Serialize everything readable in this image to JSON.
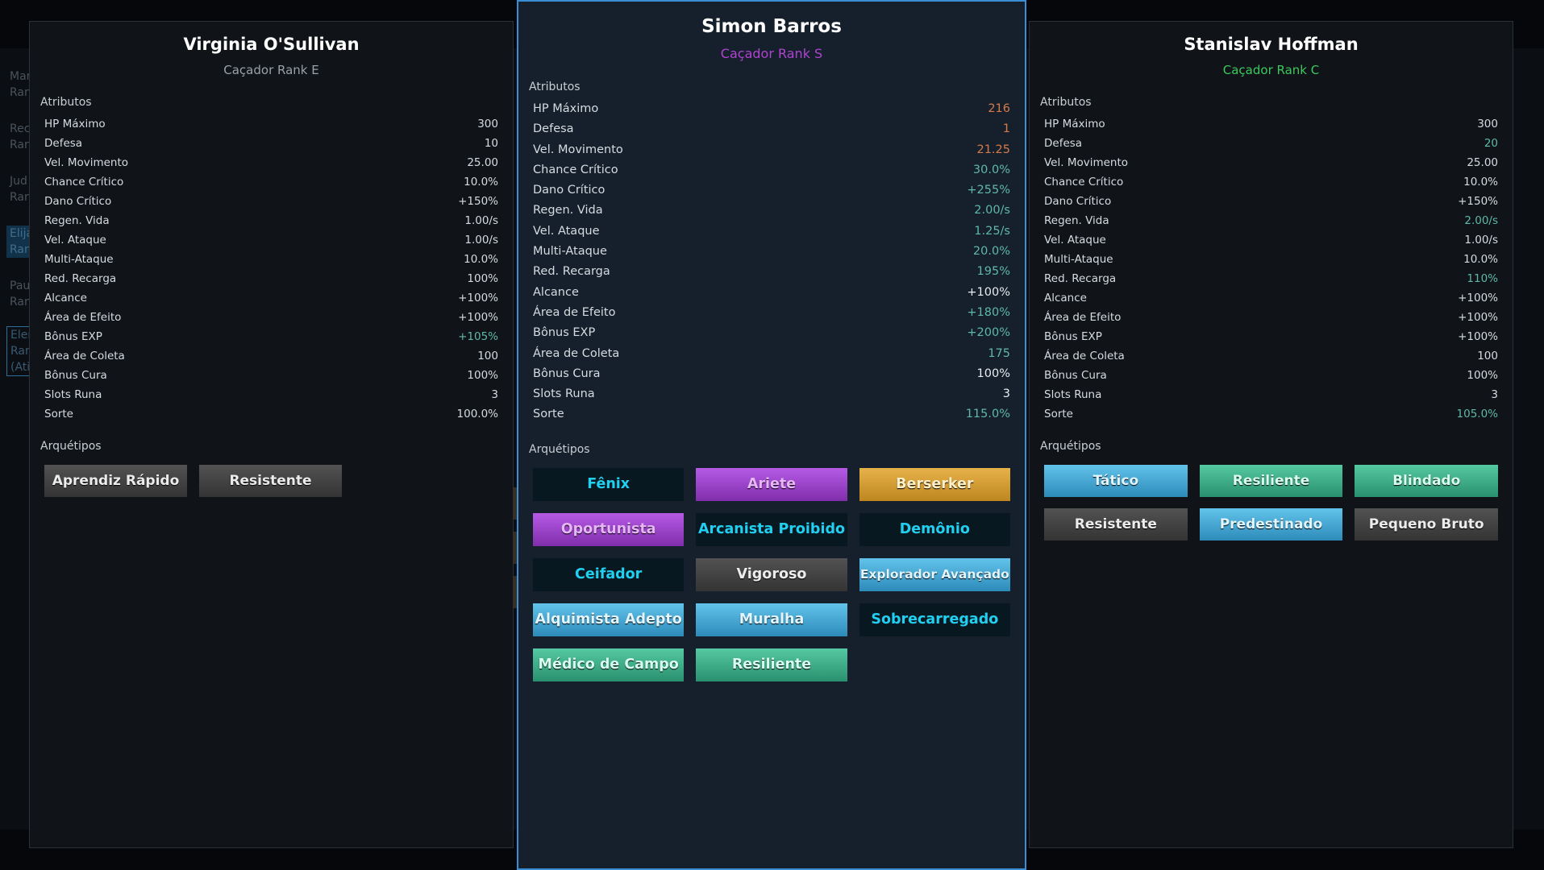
{
  "background_list": [
    {
      "line1": "Mar",
      "line2": "Ran"
    },
    {
      "line1": "Rec",
      "line2": "Ran"
    },
    {
      "line1": "Jud",
      "line2": "Ran"
    },
    {
      "line1": "Elija",
      "line2": "Ran"
    },
    {
      "line1": "Pau",
      "line2": "Ran"
    },
    {
      "line1": "Elen",
      "line2": "Ran",
      "line3": "(Ati"
    }
  ],
  "labels": {
    "attributes": "Atributos",
    "archetypes": "Arquétipos"
  },
  "panels": {
    "left": {
      "name": "Virginia O'Sullivan",
      "rank": "Caçador Rank E",
      "attributes": [
        {
          "label": "HP Máximo",
          "value": "300"
        },
        {
          "label": "Defesa",
          "value": "10"
        },
        {
          "label": "Vel. Movimento",
          "value": "25.00"
        },
        {
          "label": "Chance Crítico",
          "value": "10.0%"
        },
        {
          "label": "Dano Crítico",
          "value": "+150%"
        },
        {
          "label": "Regen. Vida",
          "value": "1.00/s"
        },
        {
          "label": "Vel. Ataque",
          "value": "1.00/s"
        },
        {
          "label": "Multi-Ataque",
          "value": "10.0%"
        },
        {
          "label": "Red. Recarga",
          "value": "100%"
        },
        {
          "label": "Alcance",
          "value": "+100%"
        },
        {
          "label": "Área de Efeito",
          "value": "+100%"
        },
        {
          "label": "Bônus EXP",
          "value": "+105%"
        },
        {
          "label": "Área de Coleta",
          "value": "100"
        },
        {
          "label": "Bônus Cura",
          "value": "100%"
        },
        {
          "label": "Slots Runa",
          "value": "3"
        },
        {
          "label": "Sorte",
          "value": "100.0%"
        }
      ],
      "archetypes": [
        "Aprendiz Rápido",
        "Resistente"
      ]
    },
    "center": {
      "name": "Simon Barros",
      "rank": "Caçador Rank S",
      "attributes": [
        {
          "label": "HP Máximo",
          "value": "216"
        },
        {
          "label": "Defesa",
          "value": "1"
        },
        {
          "label": "Vel. Movimento",
          "value": "21.25"
        },
        {
          "label": "Chance Crítico",
          "value": "30.0%"
        },
        {
          "label": "Dano Crítico",
          "value": "+255%"
        },
        {
          "label": "Regen. Vida",
          "value": "2.00/s"
        },
        {
          "label": "Vel. Ataque",
          "value": "1.25/s"
        },
        {
          "label": "Multi-Ataque",
          "value": "20.0%"
        },
        {
          "label": "Red. Recarga",
          "value": "195%"
        },
        {
          "label": "Alcance",
          "value": "+100%"
        },
        {
          "label": "Área de Efeito",
          "value": "+180%"
        },
        {
          "label": "Bônus EXP",
          "value": "+200%"
        },
        {
          "label": "Área de Coleta",
          "value": "175"
        },
        {
          "label": "Bônus Cura",
          "value": "100%"
        },
        {
          "label": "Slots Runa",
          "value": "3"
        },
        {
          "label": "Sorte",
          "value": "115.0%"
        }
      ],
      "archetypes": [
        "Fênix",
        "Ariete",
        "Berserker",
        "Oportunista",
        "Arcanista Proibido",
        "Demônio",
        "Ceifador",
        "Vigoroso",
        "Explorador Avançado",
        "Alquimista Adepto",
        "Muralha",
        "Sobrecarregado",
        "Médico de Campo",
        "Resiliente"
      ]
    },
    "right": {
      "name": "Stanislav Hoffman",
      "rank": "Caçador Rank C",
      "attributes": [
        {
          "label": "HP Máximo",
          "value": "300"
        },
        {
          "label": "Defesa",
          "value": "20"
        },
        {
          "label": "Vel. Movimento",
          "value": "25.00"
        },
        {
          "label": "Chance Crítico",
          "value": "10.0%"
        },
        {
          "label": "Dano Crítico",
          "value": "+150%"
        },
        {
          "label": "Regen. Vida",
          "value": "2.00/s"
        },
        {
          "label": "Vel. Ataque",
          "value": "1.00/s"
        },
        {
          "label": "Multi-Ataque",
          "value": "10.0%"
        },
        {
          "label": "Red. Recarga",
          "value": "110%"
        },
        {
          "label": "Alcance",
          "value": "+100%"
        },
        {
          "label": "Área de Efeito",
          "value": "+100%"
        },
        {
          "label": "Bônus EXP",
          "value": "+100%"
        },
        {
          "label": "Área de Coleta",
          "value": "100"
        },
        {
          "label": "Bônus Cura",
          "value": "100%"
        },
        {
          "label": "Slots Runa",
          "value": "3"
        },
        {
          "label": "Sorte",
          "value": "105.0%"
        }
      ],
      "archetypes": [
        "Tático",
        "Resiliente",
        "Blindado",
        "Resistente",
        "Predestinado",
        "Pequeno Bruto"
      ]
    }
  },
  "colors": {
    "rank_s": "#b043d1",
    "rank_c": "#3cc95c",
    "rank_e": "#9aa1a8",
    "stat_buff": "#5fb8a8",
    "stat_debuff": "#d67a4a",
    "selected_border": "#3b8ed6"
  }
}
